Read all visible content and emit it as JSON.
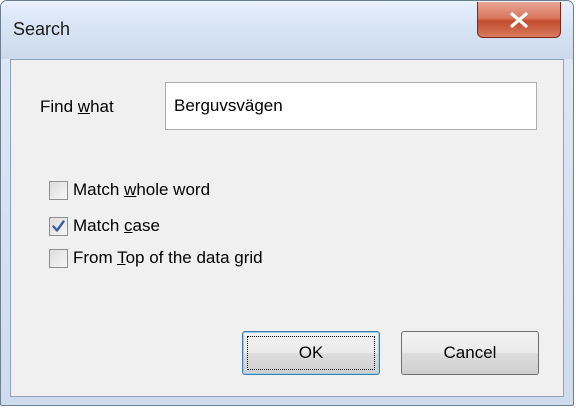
{
  "window": {
    "title": "Search",
    "close_icon": "close-icon"
  },
  "form": {
    "find_label_prefix": "Find ",
    "find_label_access": "w",
    "find_label_suffix": "hat",
    "find_value": "Berguvsvägen"
  },
  "options": [
    {
      "prefix": "Match ",
      "access": "w",
      "suffix": "hole word",
      "checked": false
    },
    {
      "prefix": "Match ",
      "access": "c",
      "suffix": "ase",
      "checked": true
    },
    {
      "prefix": "From ",
      "access": "T",
      "suffix": "op of the data grid",
      "checked": false
    }
  ],
  "buttons": {
    "ok_label": "OK",
    "cancel_label": "Cancel"
  },
  "colors": {
    "close_button": "#c24b2e",
    "check_mark": "#3b5ca8",
    "default_button_border": "#3c7fb1"
  }
}
